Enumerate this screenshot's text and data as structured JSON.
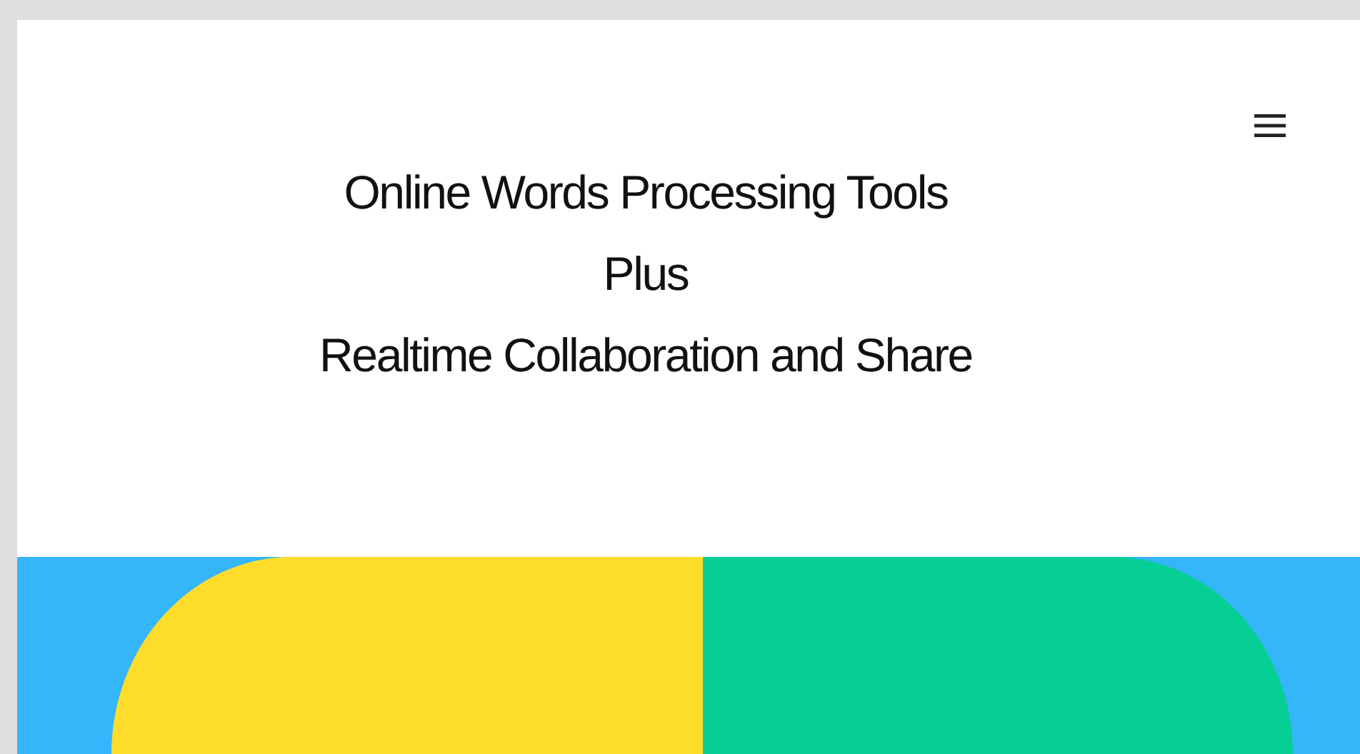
{
  "header": {
    "title_lines": [
      "Online Words Processing Tools",
      "Plus",
      "Realtime Collaboration and Share"
    ]
  },
  "hero": {
    "shapes": [
      {
        "kind": "left",
        "color": "#fddc2c"
      },
      {
        "kind": "right",
        "color": "#05cf95"
      }
    ]
  }
}
